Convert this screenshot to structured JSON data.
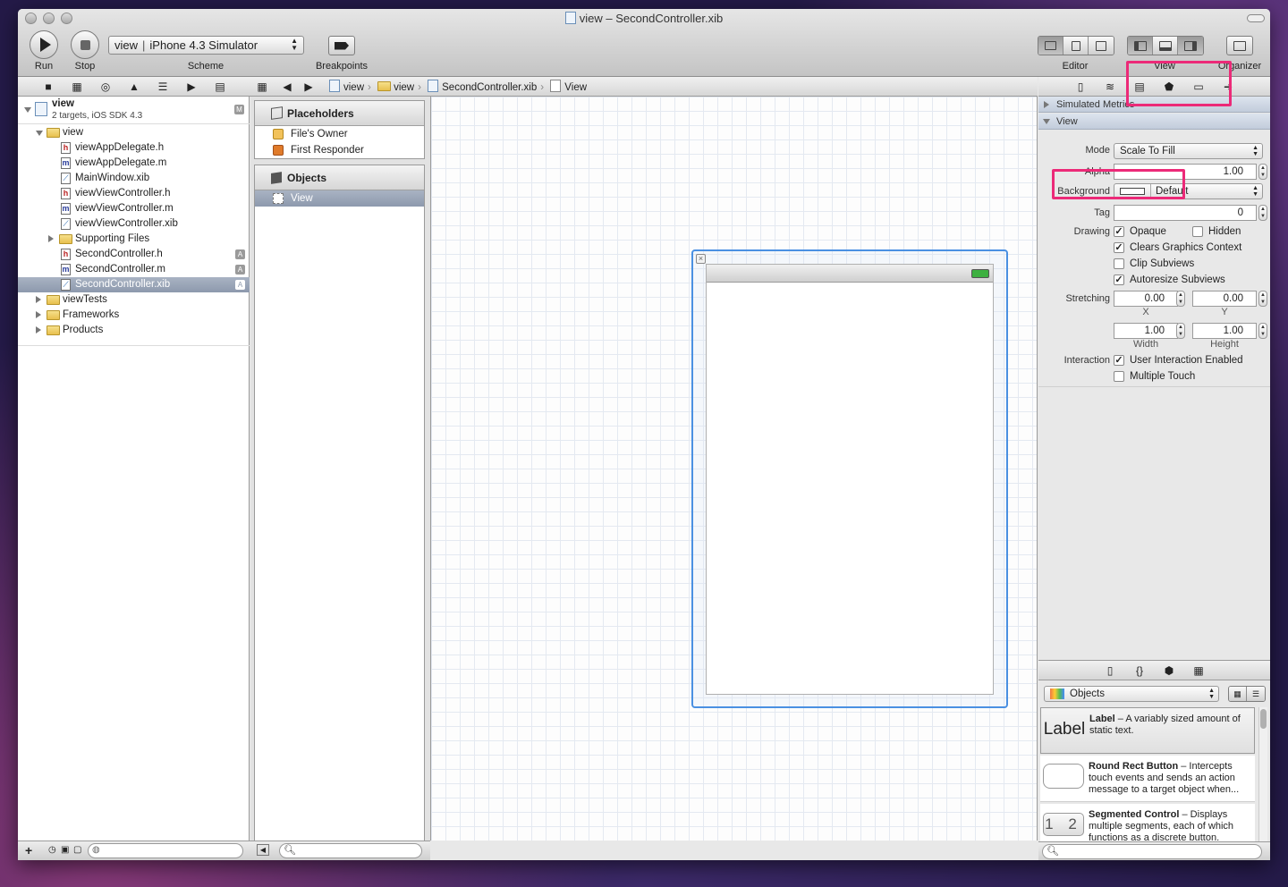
{
  "window": {
    "title": "view – SecondController.xib"
  },
  "toolbar": {
    "run_label": "Run",
    "stop_label": "Stop",
    "scheme_target": "view",
    "scheme_destination": "iPhone 4.3 Simulator",
    "scheme_label": "Scheme",
    "breakpoints_label": "Breakpoints",
    "editor_label": "Editor",
    "view_label": "View",
    "organizer_label": "Organizer"
  },
  "jumpbar": {
    "items": [
      "view",
      "view",
      "SecondController.xib",
      "View"
    ]
  },
  "navigator": {
    "project_name": "view",
    "project_sub": "2 targets, iOS SDK 4.3",
    "project_badge": "M",
    "items": [
      {
        "label": "view",
        "type": "folder"
      },
      {
        "label": "viewAppDelegate.h",
        "type": "h"
      },
      {
        "label": "viewAppDelegate.m",
        "type": "m"
      },
      {
        "label": "MainWindow.xib",
        "type": "xib"
      },
      {
        "label": "viewViewController.h",
        "type": "h"
      },
      {
        "label": "viewViewController.m",
        "type": "m"
      },
      {
        "label": "viewViewController.xib",
        "type": "xib"
      },
      {
        "label": "Supporting Files",
        "type": "folder"
      },
      {
        "label": "SecondController.h",
        "type": "h",
        "badge": "A"
      },
      {
        "label": "SecondController.m",
        "type": "m",
        "badge": "A"
      },
      {
        "label": "SecondController.xib",
        "type": "xib",
        "badge": "A",
        "selected": true
      },
      {
        "label": "viewTests",
        "type": "folder"
      },
      {
        "label": "Frameworks",
        "type": "folder"
      },
      {
        "label": "Products",
        "type": "folder"
      }
    ]
  },
  "outline": {
    "placeholders_title": "Placeholders",
    "placeholders": [
      "File's Owner",
      "First Responder"
    ],
    "objects_title": "Objects",
    "objects": [
      "View"
    ]
  },
  "inspector": {
    "simulated_metrics": "Simulated Metrics",
    "view_section": "View",
    "mode_label": "Mode",
    "mode_value": "Scale To Fill",
    "alpha_label": "Alpha",
    "alpha_value": "1.00",
    "background_label": "Background",
    "background_value": "Default",
    "tag_label": "Tag",
    "tag_value": "0",
    "drawing_label": "Drawing",
    "opaque": "Opaque",
    "hidden": "Hidden",
    "clears": "Clears Graphics Context",
    "clip": "Clip Subviews",
    "autoresize": "Autoresize Subviews",
    "stretching_label": "Stretching",
    "stretch_x": "0.00",
    "stretch_y": "0.00",
    "x_label": "X",
    "y_label": "Y",
    "stretch_w": "1.00",
    "stretch_h": "1.00",
    "w_label": "Width",
    "h_label": "Height",
    "interaction_label": "Interaction",
    "user_interaction": "User Interaction Enabled",
    "multiple_touch": "Multiple Touch"
  },
  "library": {
    "filter": "Objects",
    "items": [
      {
        "icon_text": "Label",
        "title": "Label",
        "desc": " – A variably sized amount of static text."
      },
      {
        "icon_text": "",
        "title": "Round Rect Button",
        "desc": " – Intercepts touch events and sends an action message to a target object when..."
      },
      {
        "icon_text": "1 2",
        "title": "Segmented Control",
        "desc": " – Displays multiple segments, each of which functions as a discrete button."
      }
    ]
  },
  "checks": {
    "mark": "✓"
  }
}
